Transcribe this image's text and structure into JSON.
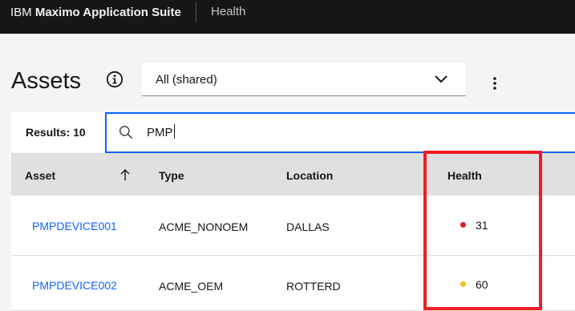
{
  "header": {
    "brand_prefix": "IBM",
    "brand_product": "Maximo Application Suite",
    "app_name": "Health"
  },
  "page": {
    "title": "Assets",
    "view_select": {
      "value": "All (shared)"
    }
  },
  "results": {
    "label": "Results: 10"
  },
  "search": {
    "value": "PMP"
  },
  "table": {
    "columns": [
      "Asset",
      "Type",
      "Location",
      "Health"
    ],
    "sort_column": "Asset",
    "sort_direction": "ascending",
    "rows": [
      {
        "asset": "PMPDEVICE001",
        "type": "ACME_NONOEM",
        "location": "DALLAS",
        "health": "31",
        "health_color": "#da1e28"
      },
      {
        "asset": "PMPDEVICE002",
        "type": "ACME_OEM",
        "location": "ROTTERD",
        "health": "60",
        "health_color": "#f1c21b"
      }
    ]
  },
  "annotation": {
    "color": "#ee1c25",
    "target": "Health"
  },
  "colors": {
    "header_bg": "#161616",
    "link": "#0f62fe",
    "focus_border": "#0f62fe",
    "table_header_bg": "#e0e0e0",
    "page_bg": "#f4f4f4"
  },
  "icons": {
    "info": "info-icon",
    "chevron": "chevron-down-icon",
    "overflow": "overflow-menu-vertical-icon",
    "search": "search-icon",
    "sort": "arrow-up-icon"
  }
}
